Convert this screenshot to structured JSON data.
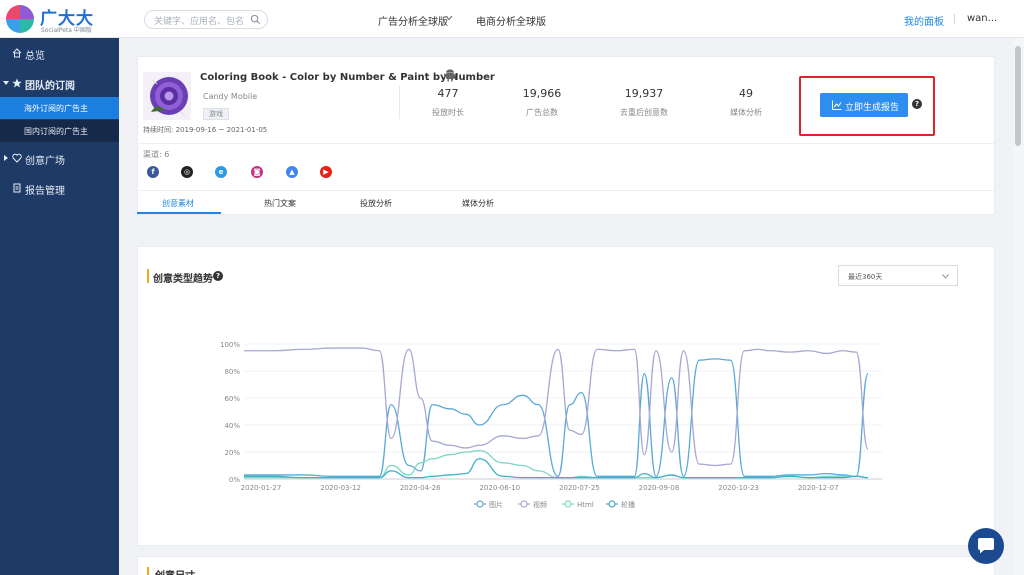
{
  "brand": {
    "name": "广大大",
    "sub": "SocialPeta 中国版"
  },
  "topbar": {
    "search_placeholder": "关键字、应用名、包名",
    "nav": [
      "广告分析全球版",
      "电商分析全球版"
    ],
    "my_panel": "我的面板",
    "user": "wan..."
  },
  "sidebar": {
    "overview": "总览",
    "team_subs": "团队的订阅",
    "overseas": "海外订阅的广告主",
    "domestic": "国内订阅的广告主",
    "creative": "创意广场",
    "reports": "报告管理"
  },
  "app": {
    "title": "Coloring Book - Color by Number & Paint by Number",
    "developer": "Candy Mobile",
    "tag": "游戏",
    "duration": "持续时间: 2019-09-16 ~ 2021-01-05",
    "stats": [
      {
        "value": "477",
        "label": "投放时长"
      },
      {
        "value": "19,966",
        "label": "广告总数"
      },
      {
        "value": "19,937",
        "label": "去重后创意数"
      },
      {
        "value": "49",
        "label": "媒体分析"
      }
    ],
    "report_button": "立即生成报告",
    "channels_label": "渠道: 6",
    "channels": [
      {
        "name": "facebook-icon",
        "glyph": "f",
        "color": "#3b5998"
      },
      {
        "name": "messenger-icon",
        "glyph": "◎",
        "color": "#222"
      },
      {
        "name": "audience-network-icon",
        "glyph": "e",
        "color": "#2d9be3"
      },
      {
        "name": "instagram-icon",
        "glyph": "◙",
        "color": "#c13584"
      },
      {
        "name": "google-ads-icon",
        "glyph": "▲",
        "color": "#4285f4"
      },
      {
        "name": "youtube-icon",
        "glyph": "▶",
        "color": "#e62117"
      }
    ]
  },
  "tabs": [
    "创意素材",
    "热门文案",
    "投放分析",
    "媒体分析"
  ],
  "trend": {
    "title": "创意类型趋势",
    "range": "最近360天"
  },
  "next_section": "创意尺寸",
  "chart_data": {
    "type": "line",
    "title": "创意类型趋势",
    "x_ticks": [
      "2020-01-27",
      "2020-03-12",
      "2020-04-26",
      "2020-06-10",
      "2020-07-25",
      "2020-09-08",
      "2020-10-23",
      "2020-12-07"
    ],
    "y_ticks": [
      "0%",
      "20%",
      "40%",
      "60%",
      "80%",
      "100%"
    ],
    "ylim": [
      0,
      100
    ],
    "x": [
      0,
      15,
      30,
      45,
      60,
      69,
      75,
      84,
      90,
      96,
      105,
      113,
      120,
      132,
      142,
      150,
      160,
      166,
      172,
      180,
      190,
      199,
      204,
      210,
      218,
      224,
      232,
      240,
      248,
      255,
      262,
      268,
      278,
      288,
      297,
      305,
      312,
      318
    ],
    "series": [
      {
        "name": "图片",
        "color": "#5aa9d6",
        "values": [
          3,
          3,
          3,
          2,
          2,
          2,
          55,
          10,
          6,
          55,
          52,
          48,
          40,
          55,
          62,
          55,
          2,
          55,
          64,
          2,
          2,
          2,
          78,
          2,
          75,
          2,
          88,
          89,
          88,
          2,
          2,
          2,
          3,
          3,
          4,
          3,
          2,
          78
        ]
      },
      {
        "name": "视频",
        "color": "#a5a8d4",
        "values": [
          95,
          95,
          96,
          97,
          97,
          95,
          30,
          96,
          60,
          28,
          25,
          23,
          25,
          32,
          30,
          32,
          96,
          36,
          33,
          96,
          95,
          96,
          18,
          95,
          20,
          95,
          11,
          10,
          11,
          95,
          96,
          95,
          94,
          95,
          93,
          95,
          94,
          22
        ]
      },
      {
        "name": "Html",
        "color": "#7fd6c4",
        "values": [
          1,
          1,
          1,
          1,
          1,
          1,
          10,
          3,
          12,
          15,
          18,
          20,
          21,
          12,
          10,
          6,
          1,
          1,
          2,
          1,
          1,
          1,
          1,
          1,
          3,
          1,
          1,
          1,
          1,
          1,
          1,
          1,
          2,
          1,
          2,
          2,
          2,
          1
        ]
      },
      {
        "name": "轮播",
        "color": "#3fb1c8",
        "values": [
          2,
          2,
          1,
          1,
          1,
          1,
          6,
          1,
          1,
          2,
          3,
          4,
          15,
          2,
          1,
          1,
          1,
          1,
          1,
          1,
          1,
          1,
          4,
          1,
          3,
          1,
          1,
          1,
          1,
          1,
          1,
          1,
          2,
          1,
          1,
          1,
          2,
          1
        ]
      }
    ],
    "legend": "bottom"
  }
}
